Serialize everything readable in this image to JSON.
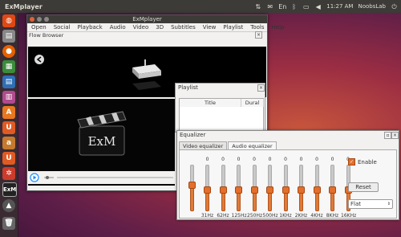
{
  "top_panel": {
    "title": "ExMplayer",
    "time": "11:27 AM",
    "user": "NoobsLab"
  },
  "main_window": {
    "title": "ExMplayer"
  },
  "menu": [
    "Open",
    "Social",
    "Playback",
    "Audio",
    "Video",
    "3D",
    "Subtitles",
    "View",
    "Playlist",
    "Tools",
    "Help"
  ],
  "flow_browser": {
    "label": "Flow Browser"
  },
  "video": {
    "logo_text": "ExM"
  },
  "playlist": {
    "title": "Playlist",
    "col_title": "Title",
    "col_duration": "Dural"
  },
  "equalizer": {
    "title": "Equalizer",
    "tabs": [
      "Video equalizer",
      "Audio equalizer"
    ],
    "active_tab": "Audio equalizer",
    "bands": [
      {
        "label": "31Hz",
        "value": "0"
      },
      {
        "label": "62Hz",
        "value": "0"
      },
      {
        "label": "125Hz",
        "value": "0"
      },
      {
        "label": "250Hz",
        "value": "0"
      },
      {
        "label": "500Hz",
        "value": "0"
      },
      {
        "label": "1KHz",
        "value": "0"
      },
      {
        "label": "2KHz",
        "value": "0"
      },
      {
        "label": "4KHz",
        "value": "0"
      },
      {
        "label": "8KHz",
        "value": "0"
      },
      {
        "label": "16KHz",
        "value": "0"
      }
    ],
    "preamp_fraction": 0.55,
    "band_fraction": 0.45,
    "enable_label": "Enable",
    "enabled": true,
    "reset_label": "Reset",
    "preset_value": "Flat"
  },
  "colors": {
    "accent": "#e46f2a",
    "panel": "#3c3b37"
  }
}
